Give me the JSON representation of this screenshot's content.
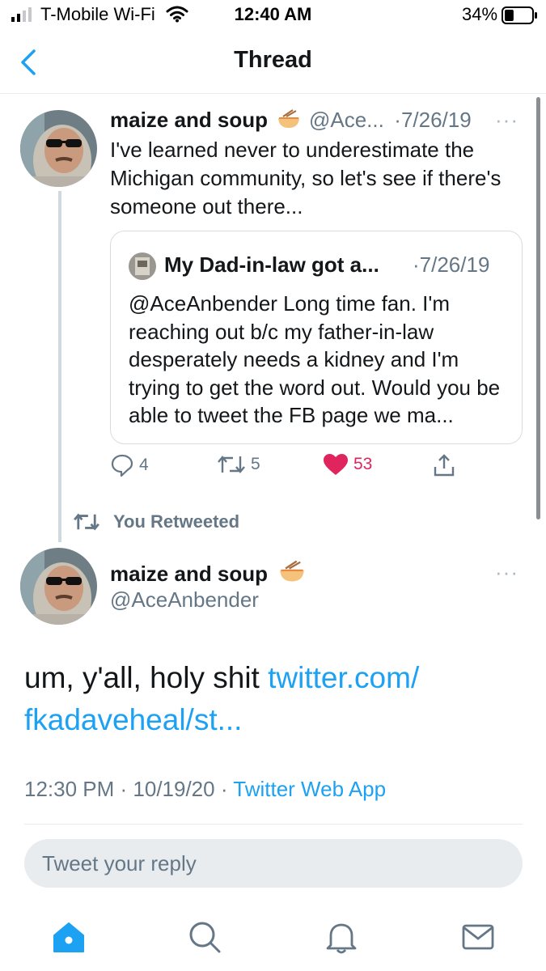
{
  "status_bar": {
    "carrier": "T-Mobile Wi-Fi",
    "time": "12:40 AM",
    "battery_percent": "34%",
    "battery_level": 0.34
  },
  "nav": {
    "title": "Thread",
    "back_icon": "chevron-left-icon"
  },
  "colors": {
    "accent": "#1da1f2",
    "like": "#e0245e",
    "secondary_text": "#657786"
  },
  "quoting_tweet": {
    "name": "maize and soup",
    "emoji": "ramen-bowl-icon",
    "handle": "@Ace...",
    "date": "·7/26/19",
    "more": "···",
    "text": "I've learned never to underestimate the Michigan community, so let's see if there's someone out there...",
    "quoted": {
      "name": "My Dad-in-law got a...",
      "date": "·7/26/19",
      "text": "@AceAnbender Long time fan. I'm reaching out b/c my father-in-law desperately needs a kidney and I'm trying to get the word out. Would you be able to tweet the FB page we ma..."
    },
    "actions": {
      "replies": "4",
      "retweets": "5",
      "likes": "53"
    }
  },
  "retweet_label": "You Retweeted",
  "main_tweet": {
    "name": "maize and soup",
    "emoji": "ramen-bowl-icon",
    "handle": "@AceAnbender",
    "more": "···",
    "text_plain": "um, y'all, holy shit ",
    "text_link_line1": "twitter.com/",
    "text_link_line2": "fkadaveheal/st...",
    "timestamp": "12:30 PM · 10/19/20 · ",
    "source": "Twitter Web App"
  },
  "reply": {
    "placeholder": "Tweet your reply"
  },
  "tabbar": {
    "items": [
      "home-icon",
      "search-icon",
      "notifications-icon",
      "messages-icon"
    ]
  }
}
